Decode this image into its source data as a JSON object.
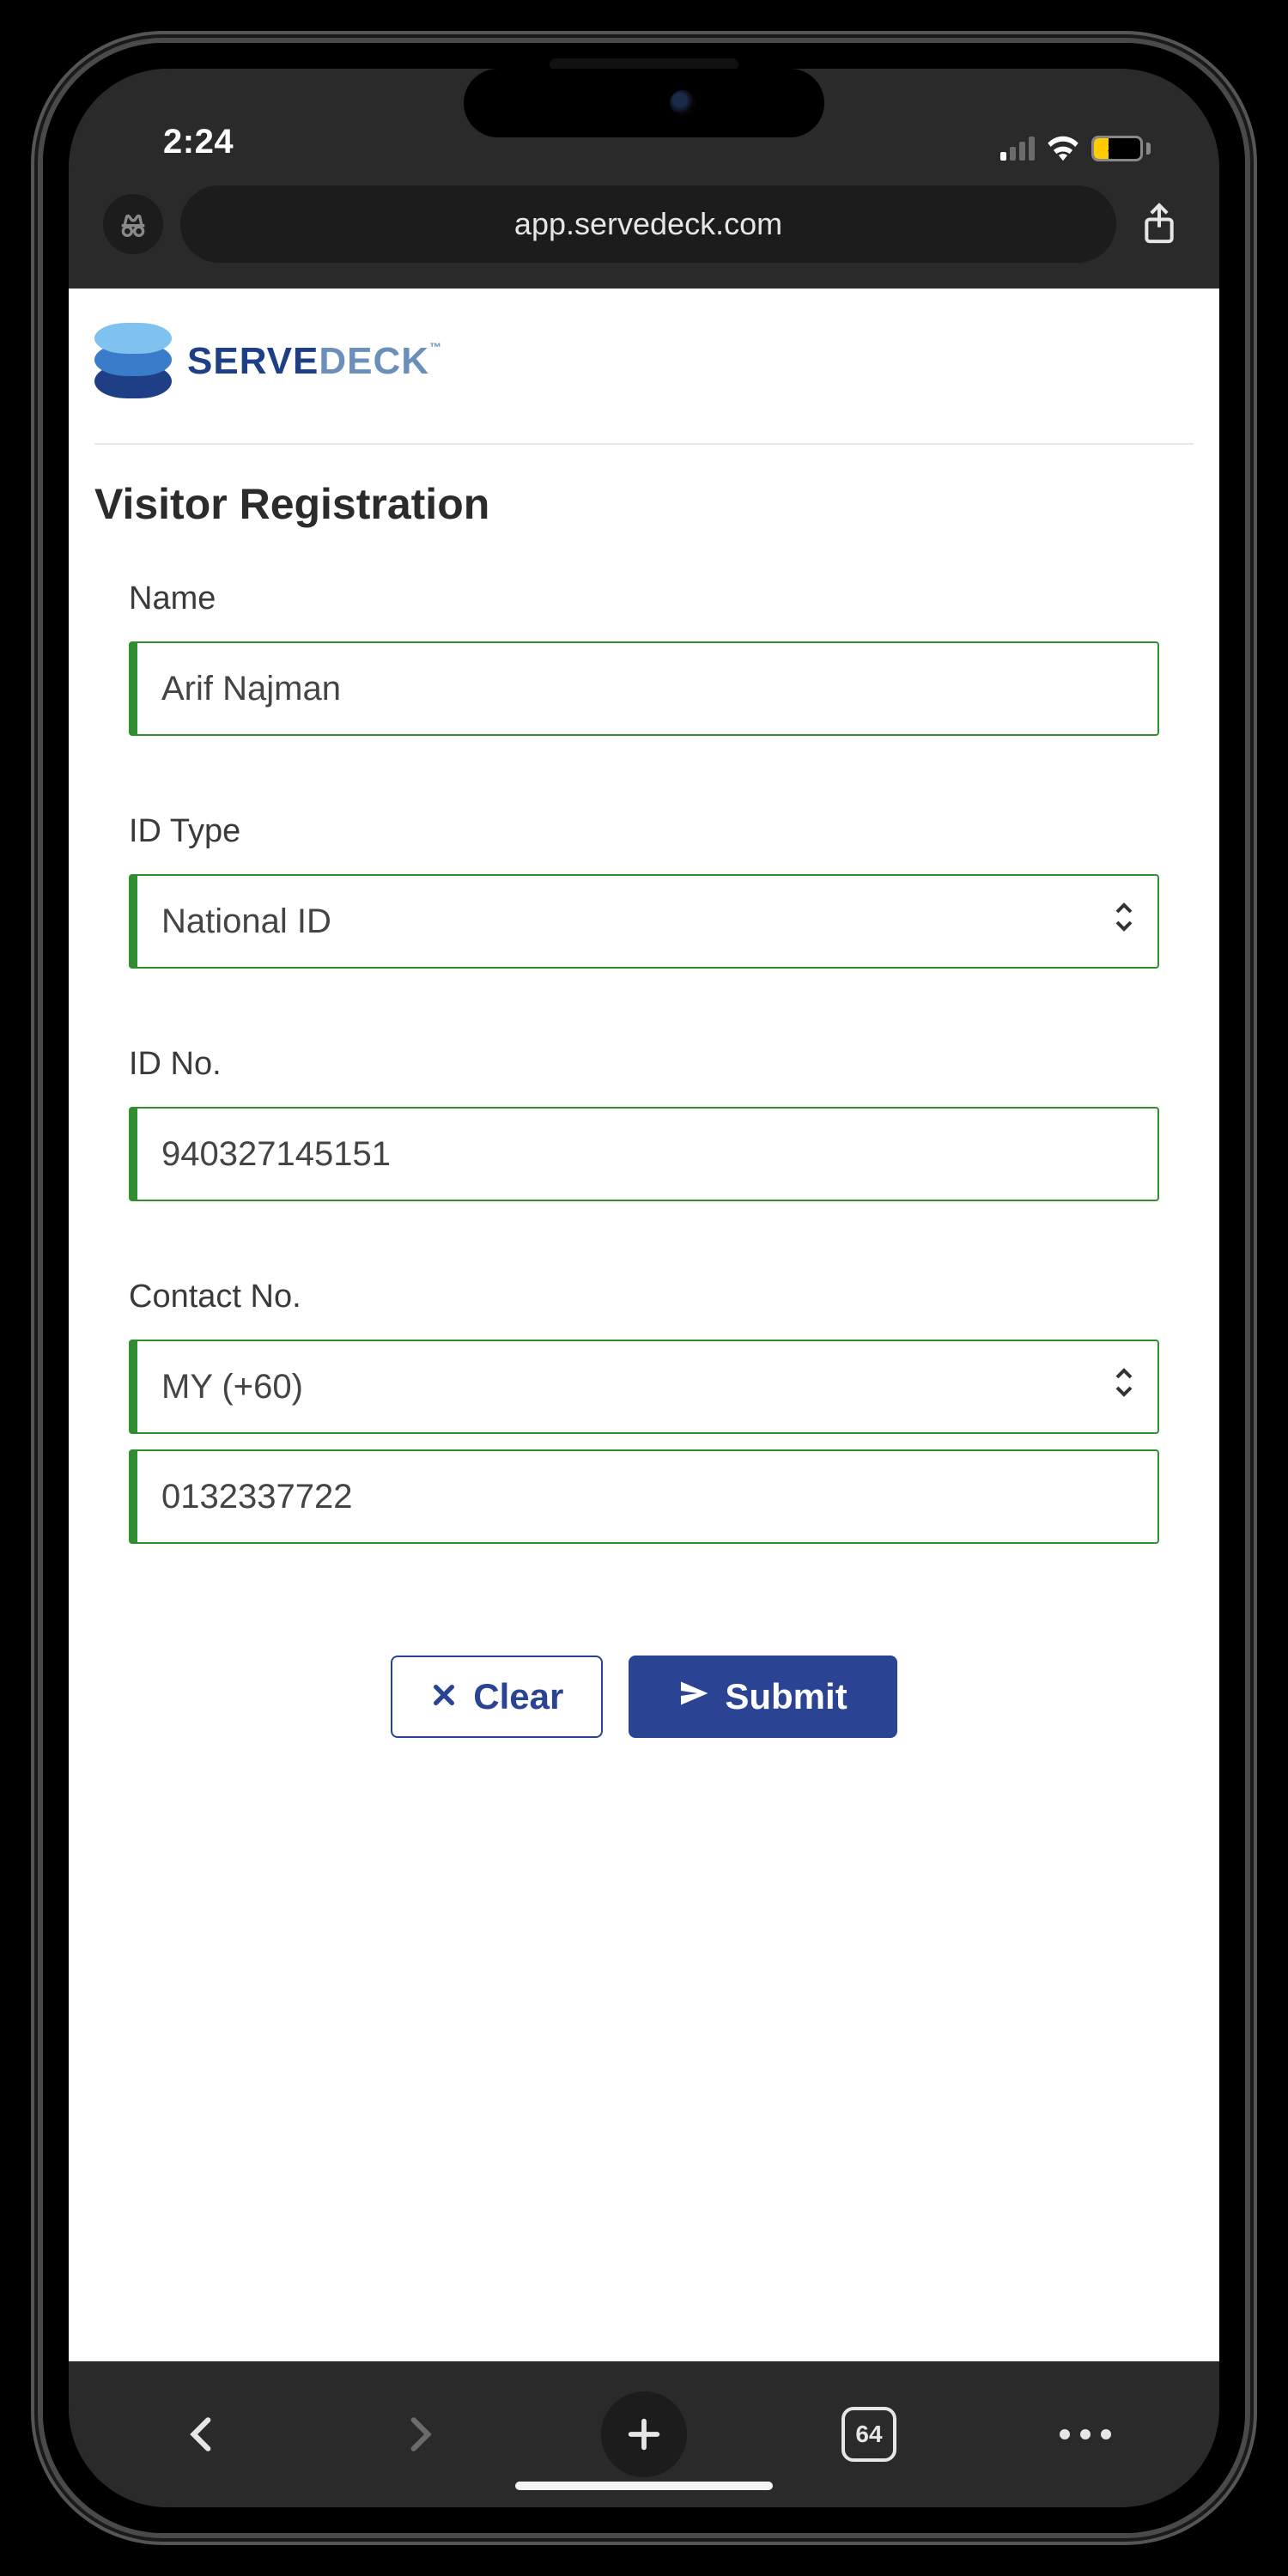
{
  "status": {
    "time": "2:24",
    "battery_pct": "31"
  },
  "browser": {
    "url": "app.servedeck.com",
    "tab_count": "64"
  },
  "brand": {
    "name_a": "SERVE",
    "name_b": "DECK",
    "tm": "™"
  },
  "page": {
    "title": "Visitor Registration"
  },
  "form": {
    "name": {
      "label": "Name",
      "value": "Arif Najman"
    },
    "id_type": {
      "label": "ID Type",
      "value": "National ID"
    },
    "id_no": {
      "label": "ID No.",
      "value": "940327145151"
    },
    "contact": {
      "label": "Contact No.",
      "country": "MY (+60)",
      "number": "0132337722"
    }
  },
  "buttons": {
    "clear": "Clear",
    "submit": "Submit"
  }
}
